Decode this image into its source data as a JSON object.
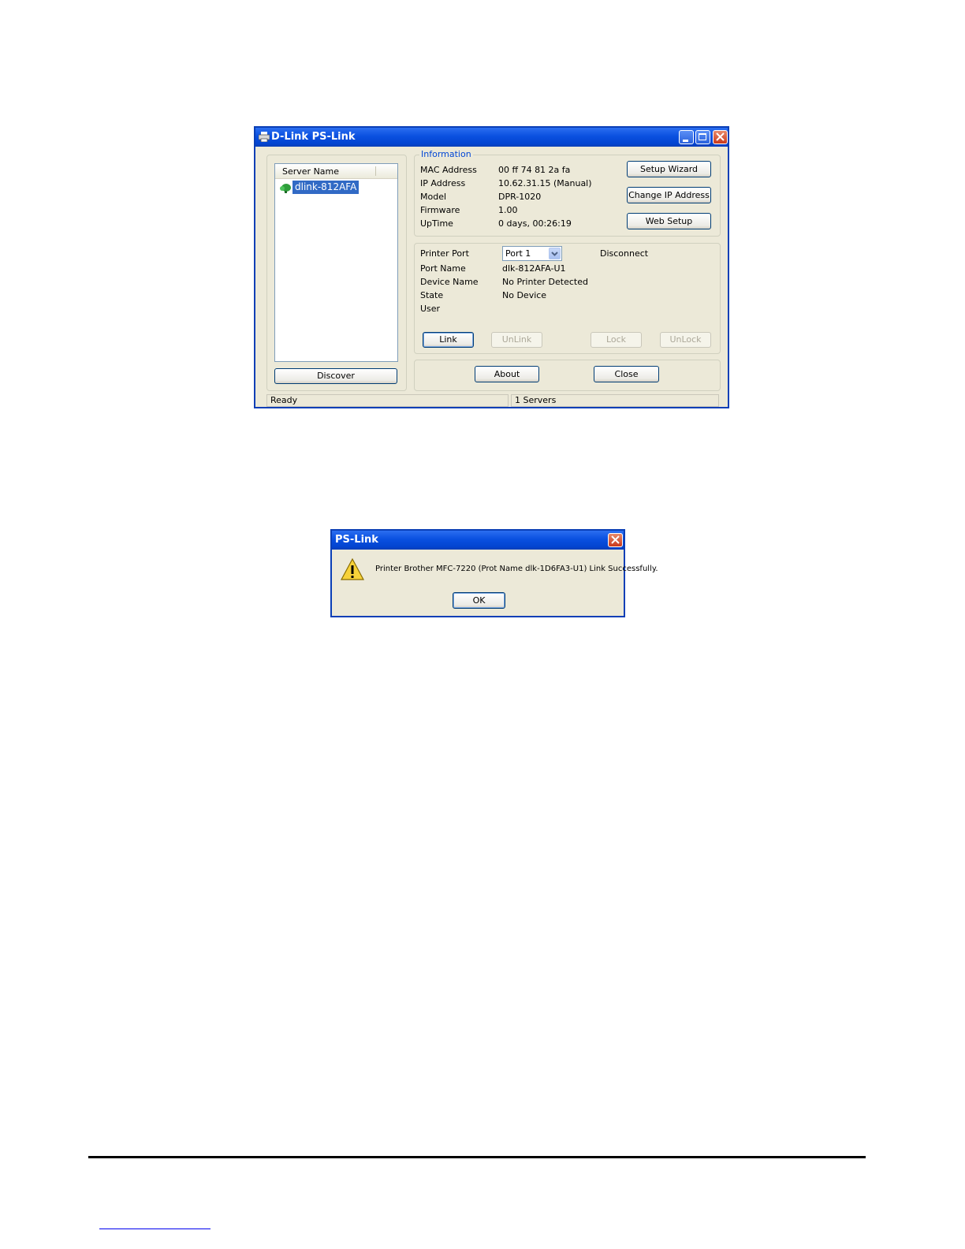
{
  "main_window": {
    "title": "D-Link PS-Link",
    "server_list": {
      "header": "Server Name",
      "items": [
        {
          "label": "dlink-812AFA",
          "selected": true
        }
      ]
    },
    "discover_label": "Discover",
    "info_group": {
      "title": "Information",
      "rows": [
        {
          "label": "MAC Address",
          "value": "00 ff 74 81 2a fa"
        },
        {
          "label": "IP Address",
          "value": "10.62.31.15 (Manual)"
        },
        {
          "label": "Model",
          "value": "DPR-1020"
        },
        {
          "label": "Firmware",
          "value": "1.00"
        },
        {
          "label": "UpTime",
          "value": "0 days, 00:26:19"
        }
      ],
      "setup_wizard_label": "Setup Wizard",
      "change_ip_label": "Change IP Address",
      "web_setup_label": "Web Setup"
    },
    "port_group": {
      "printer_port_label": "Printer Port",
      "printer_port_value": "Port 1",
      "disconnect_label": "Disconnect",
      "rows": [
        {
          "label": "Port Name",
          "value": "dlk-812AFA-U1"
        },
        {
          "label": "Device Name",
          "value": "No Printer Detected"
        },
        {
          "label": "State",
          "value": "No Device"
        },
        {
          "label": "User",
          "value": ""
        }
      ],
      "link_label": "Link",
      "unlink_label": "UnLink",
      "lock_label": "Lock",
      "unlock_label": "UnLock"
    },
    "about_label": "About",
    "close_label": "Close",
    "status": {
      "left": "Ready",
      "right": "1 Servers"
    }
  },
  "dialog": {
    "title": "PS-Link",
    "message": "Printer Brother MFC-7220 (Prot Name dlk-1D6FA3-U1) Link Successfully.",
    "ok_label": "OK"
  },
  "colors": {
    "titlebar": "#0a50e0",
    "window_bg": "#ece9d8",
    "group_label": "#0046d5",
    "selection": "#316ac5"
  }
}
